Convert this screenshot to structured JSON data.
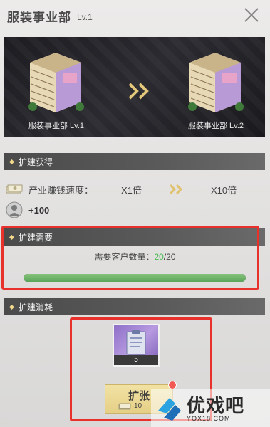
{
  "header": {
    "title": "服装事业部",
    "level": "Lv.1"
  },
  "preview": {
    "from_label": "服装事业部 Lv.1",
    "to_label": "服装事业部 Lv.2"
  },
  "gain": {
    "section_title": "扩建获得",
    "speed_label": "产业赚钱速度：",
    "speed_from": "X1倍",
    "speed_to": "X10倍",
    "bonus_value": "+100"
  },
  "requirement": {
    "section_title": "扩建需要",
    "label": "需要客户数量：",
    "current": "20",
    "separator": "/",
    "target": "20",
    "progress_fraction": 1.0
  },
  "cost": {
    "section_title": "扩建消耗",
    "item_count": "5",
    "button_label": "扩张",
    "button_cost": "10"
  },
  "watermark": {
    "brand": "优戏吧",
    "url": "YOX18.COM"
  },
  "colors": {
    "highlight": "#e8312a",
    "progress": "#5aa55a",
    "accent_green": "#44b84c"
  }
}
